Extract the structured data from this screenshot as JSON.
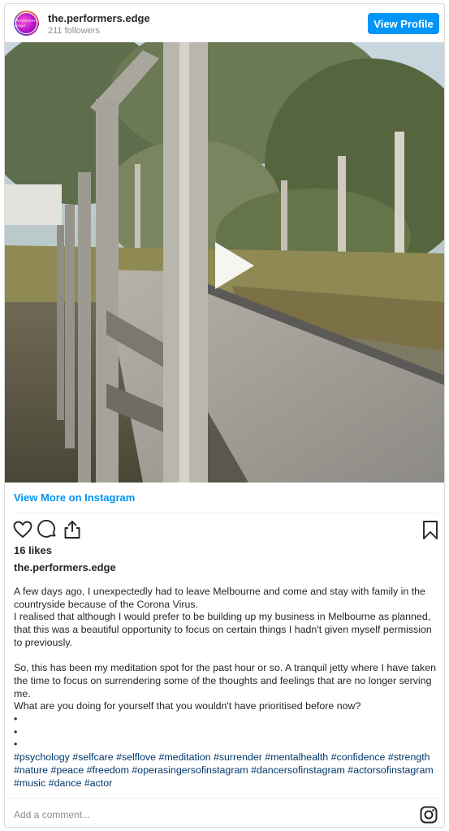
{
  "header": {
    "avatar_text": "Performers Edge",
    "username": "the.performers.edge",
    "followers": "211 followers",
    "view_profile_label": "View Profile"
  },
  "media": {
    "type": "video",
    "icon": "play-icon"
  },
  "view_more_label": "View More on Instagram",
  "actions": {
    "icons": [
      "heart-icon",
      "comment-icon",
      "share-icon",
      "bookmark-icon"
    ]
  },
  "likes": "16 likes",
  "caption": {
    "username": "the.performers.edge",
    "paragraphs": [
      "A few days ago, I unexpectedly had to leave Melbourne and come and stay with family in the countryside because of the Corona Virus.\nI realised that although I would prefer to be building up my business in Melbourne as planned, that this was a beautiful opportunity to focus on certain things I hadn't given myself permission to previously.",
      "So, this has been my meditation spot for the past hour or so. A tranquil jetty where I have taken the time to focus on surrendering some of the thoughts and feelings that are no longer serving me.\nWhat are you doing for yourself that you wouldn't have prioritised before now?\n•\n•\n•"
    ],
    "hashtags": [
      "#psychology",
      "#selfcare",
      "#selflove",
      "#meditation",
      "#surrender",
      "#mentalhealth",
      "#confidence",
      "#strength",
      "#nature",
      "#peace",
      "#freedom",
      "#operasingersofinstagram",
      "#dancersofinstagram",
      "#actorsofinstagram",
      "#music",
      "#dance",
      "#actor"
    ]
  },
  "comment": {
    "placeholder": "Add a comment...",
    "icon": "instagram-icon"
  },
  "colors": {
    "accent": "#0095f6",
    "hashtag": "#00376b",
    "muted": "#8e8e8e"
  }
}
